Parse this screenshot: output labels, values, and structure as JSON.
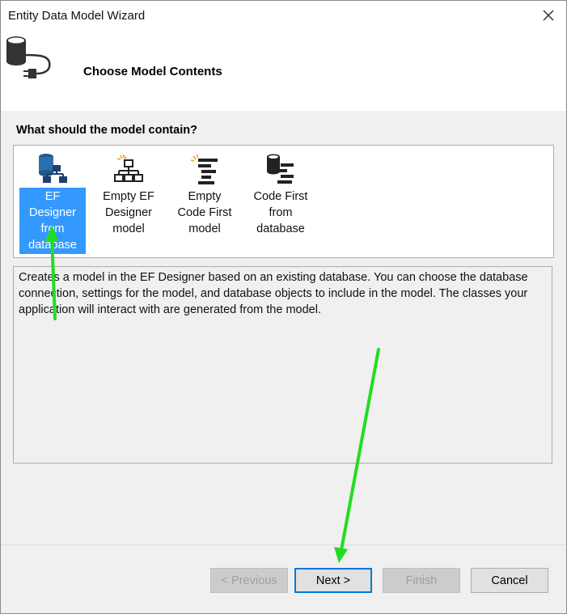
{
  "window": {
    "title": "Entity Data Model Wizard"
  },
  "header": {
    "title": "Choose Model Contents"
  },
  "prompt": "What should the model contain?",
  "choices": [
    {
      "label": "EF Designer from database",
      "icon": "database-designer-icon",
      "selected": true
    },
    {
      "label": "Empty EF Designer model",
      "icon": "empty-designer-icon",
      "selected": false
    },
    {
      "label": "Empty Code First model",
      "icon": "empty-code-first-icon",
      "selected": false
    },
    {
      "label": "Code First from database",
      "icon": "code-first-database-icon",
      "selected": false
    }
  ],
  "description": "Creates a model in the EF Designer based on an existing database. You can choose the database connection, settings for the model, and database objects to include in the model. The classes your application will interact with are generated from the model.",
  "buttons": {
    "previous": "< Previous",
    "next": "Next >",
    "finish": "Finish",
    "cancel": "Cancel"
  },
  "colors": {
    "selection": "#3399ff",
    "annotation_arrow": "#22dd22",
    "default_button_border": "#0078d7"
  }
}
